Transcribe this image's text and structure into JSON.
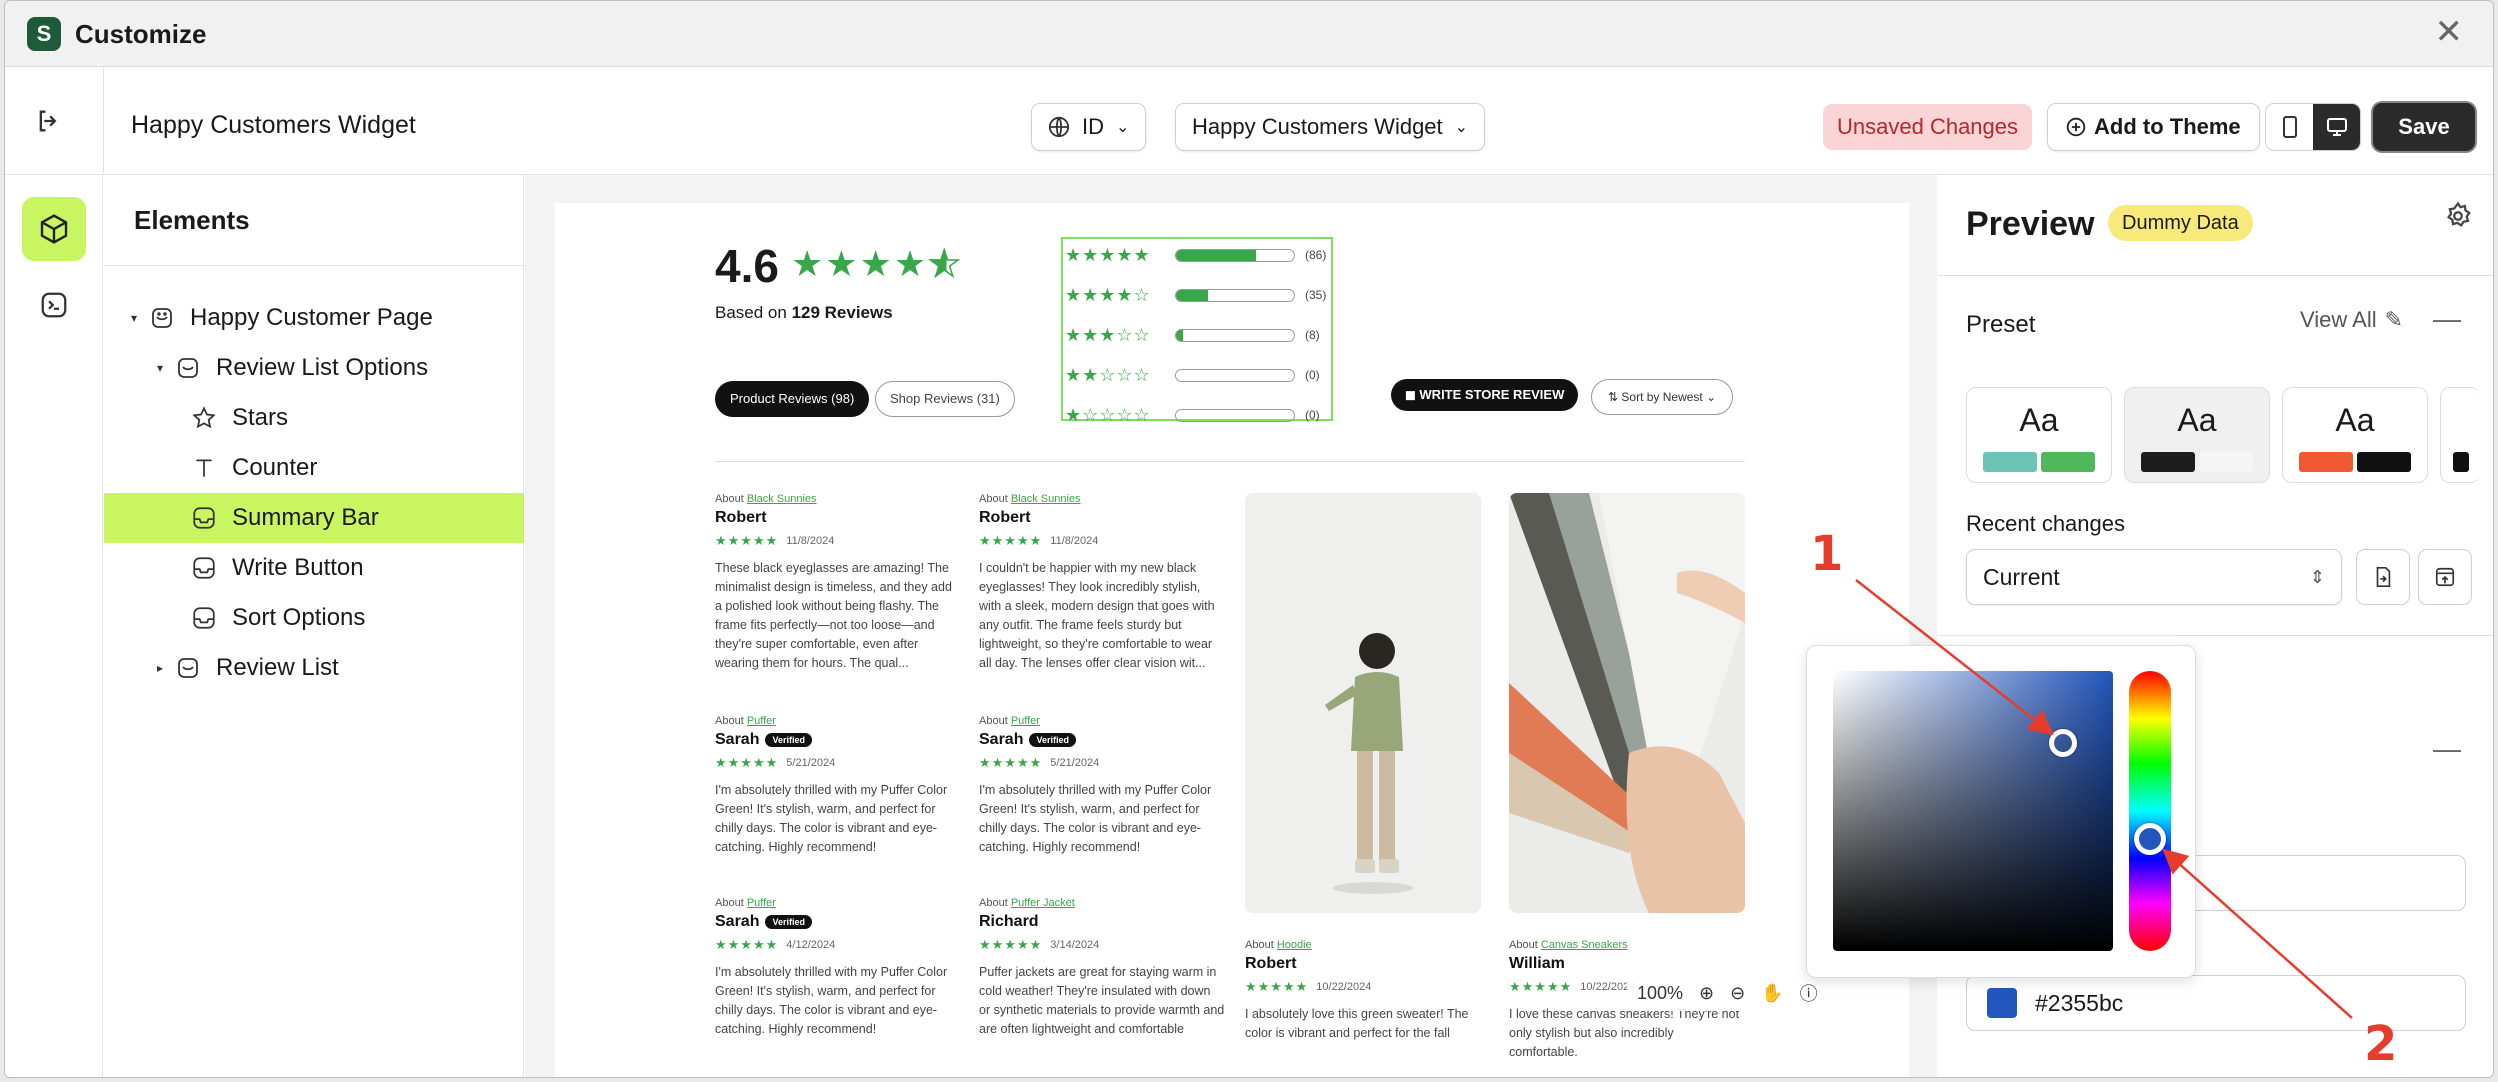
{
  "window": {
    "title": "Customize"
  },
  "toolbar": {
    "widget_name": "Happy Customers Widget",
    "language": "ID",
    "widget_select": "Happy Customers Widget",
    "unsaved": "Unsaved Changes",
    "add_to_theme": "Add to Theme",
    "save": "Save"
  },
  "tree": {
    "title": "Elements",
    "items": [
      {
        "label": "Happy Customer Page"
      },
      {
        "label": "Review List Options"
      },
      {
        "label": "Stars"
      },
      {
        "label": "Counter"
      },
      {
        "label": "Summary Bar"
      },
      {
        "label": "Write Button"
      },
      {
        "label": "Sort Options"
      },
      {
        "label": "Review List"
      }
    ]
  },
  "canvas": {
    "rating": "4.6",
    "based_prefix": "Based on ",
    "based_count": "129 Reviews",
    "summary": [
      {
        "stars": "★★★★★",
        "fill": 0.68,
        "count": "(86)"
      },
      {
        "stars": "★★★★☆",
        "fill": 0.27,
        "count": "(35)"
      },
      {
        "stars": "★★★☆☆",
        "fill": 0.06,
        "count": "(8)"
      },
      {
        "stars": "★★☆☆☆",
        "fill": 0,
        "count": "(0)"
      },
      {
        "stars": "★☆☆☆☆",
        "fill": 0,
        "count": "(0)"
      }
    ],
    "tabs": [
      "Product Reviews (98)",
      "Shop Reviews (31)"
    ],
    "write_button": "WRITE STORE REVIEW",
    "sort": "Sort by Newest",
    "reviews": [
      {
        "about": "About",
        "product": "Black Sunnies",
        "name": "Robert",
        "verified": "",
        "date": "11/8/2024",
        "body": "These black eyeglasses are amazing! The minimalist design is timeless, and they add a polished look without being flashy. The frame fits perfectly—not too loose—and they're super comfortable, even after wearing them for hours. The qual..."
      },
      {
        "about": "About",
        "product": "Black Sunnies",
        "name": "Robert",
        "verified": "",
        "date": "11/8/2024",
        "body": "I couldn't be happier with my new black eyeglasses! They look incredibly stylish, with a sleek, modern design that goes with any outfit. The frame feels sturdy but lightweight, so they're comfortable to wear all day. The lenses offer clear vision wit..."
      },
      {
        "about": "About",
        "product": "Puffer",
        "name": "Sarah",
        "verified": "Verified",
        "date": "5/21/2024",
        "body": "I'm absolutely thrilled with my Puffer Color Green! It's stylish, warm, and perfect for chilly days. The color is vibrant and eye-catching. Highly recommend!"
      },
      {
        "about": "About",
        "product": "Puffer",
        "name": "Sarah",
        "verified": "Verified",
        "date": "5/21/2024",
        "body": "I'm absolutely thrilled with my Puffer Color Green! It's stylish, warm, and perfect for chilly days. The color is vibrant and eye-catching. Highly recommend!"
      },
      {
        "about": "About",
        "product": "Puffer",
        "name": "Sarah",
        "verified": "Verified",
        "date": "4/12/2024",
        "body": "I'm absolutely thrilled with my Puffer Color Green! It's stylish, warm, and perfect for chilly days. The color is vibrant and eye-catching. Highly recommend!"
      },
      {
        "about": "About",
        "product": "Puffer Jacket",
        "name": "Richard",
        "verified": "",
        "date": "3/14/2024",
        "body": "Puffer jackets are great for staying warm in cold weather! They're insulated with down or synthetic materials to provide warmth and are often lightweight and comfortable"
      },
      {
        "about": "About",
        "product": "Hoodie",
        "name": "Robert",
        "verified": "",
        "date": "10/22/2024",
        "body": "I absolutely love this green sweater! The color is vibrant and perfect for the fall"
      },
      {
        "about": "About",
        "product": "Canvas Sneakers",
        "name": "William",
        "verified": "",
        "date": "10/22/2024",
        "body": "I love these canvas sneakers! They're not only stylish but also incredibly comfortable."
      }
    ],
    "zoom": "100%"
  },
  "panel": {
    "title": "Preview",
    "badge": "Dummy Data",
    "preset_label": "Preset",
    "view_all": "View All",
    "presets": [
      {
        "label": "Aa",
        "c1": "#6cc4b4",
        "c2": "#4fb85a"
      },
      {
        "label": "Aa",
        "c1": "#1d1d1d",
        "c2": "#f5f5f5"
      },
      {
        "label": "Aa",
        "c1": "#ef5a32",
        "c2": "#111111"
      }
    ],
    "recent_label": "Recent changes",
    "recent_value": "Current",
    "color_value": "#2355bc"
  },
  "annotations": {
    "one": "1",
    "two": "2"
  },
  "colors": {
    "accent": "#c8f560",
    "star": "#3aa64a",
    "picked": "#2355bc",
    "callout": "#e63c2c"
  }
}
